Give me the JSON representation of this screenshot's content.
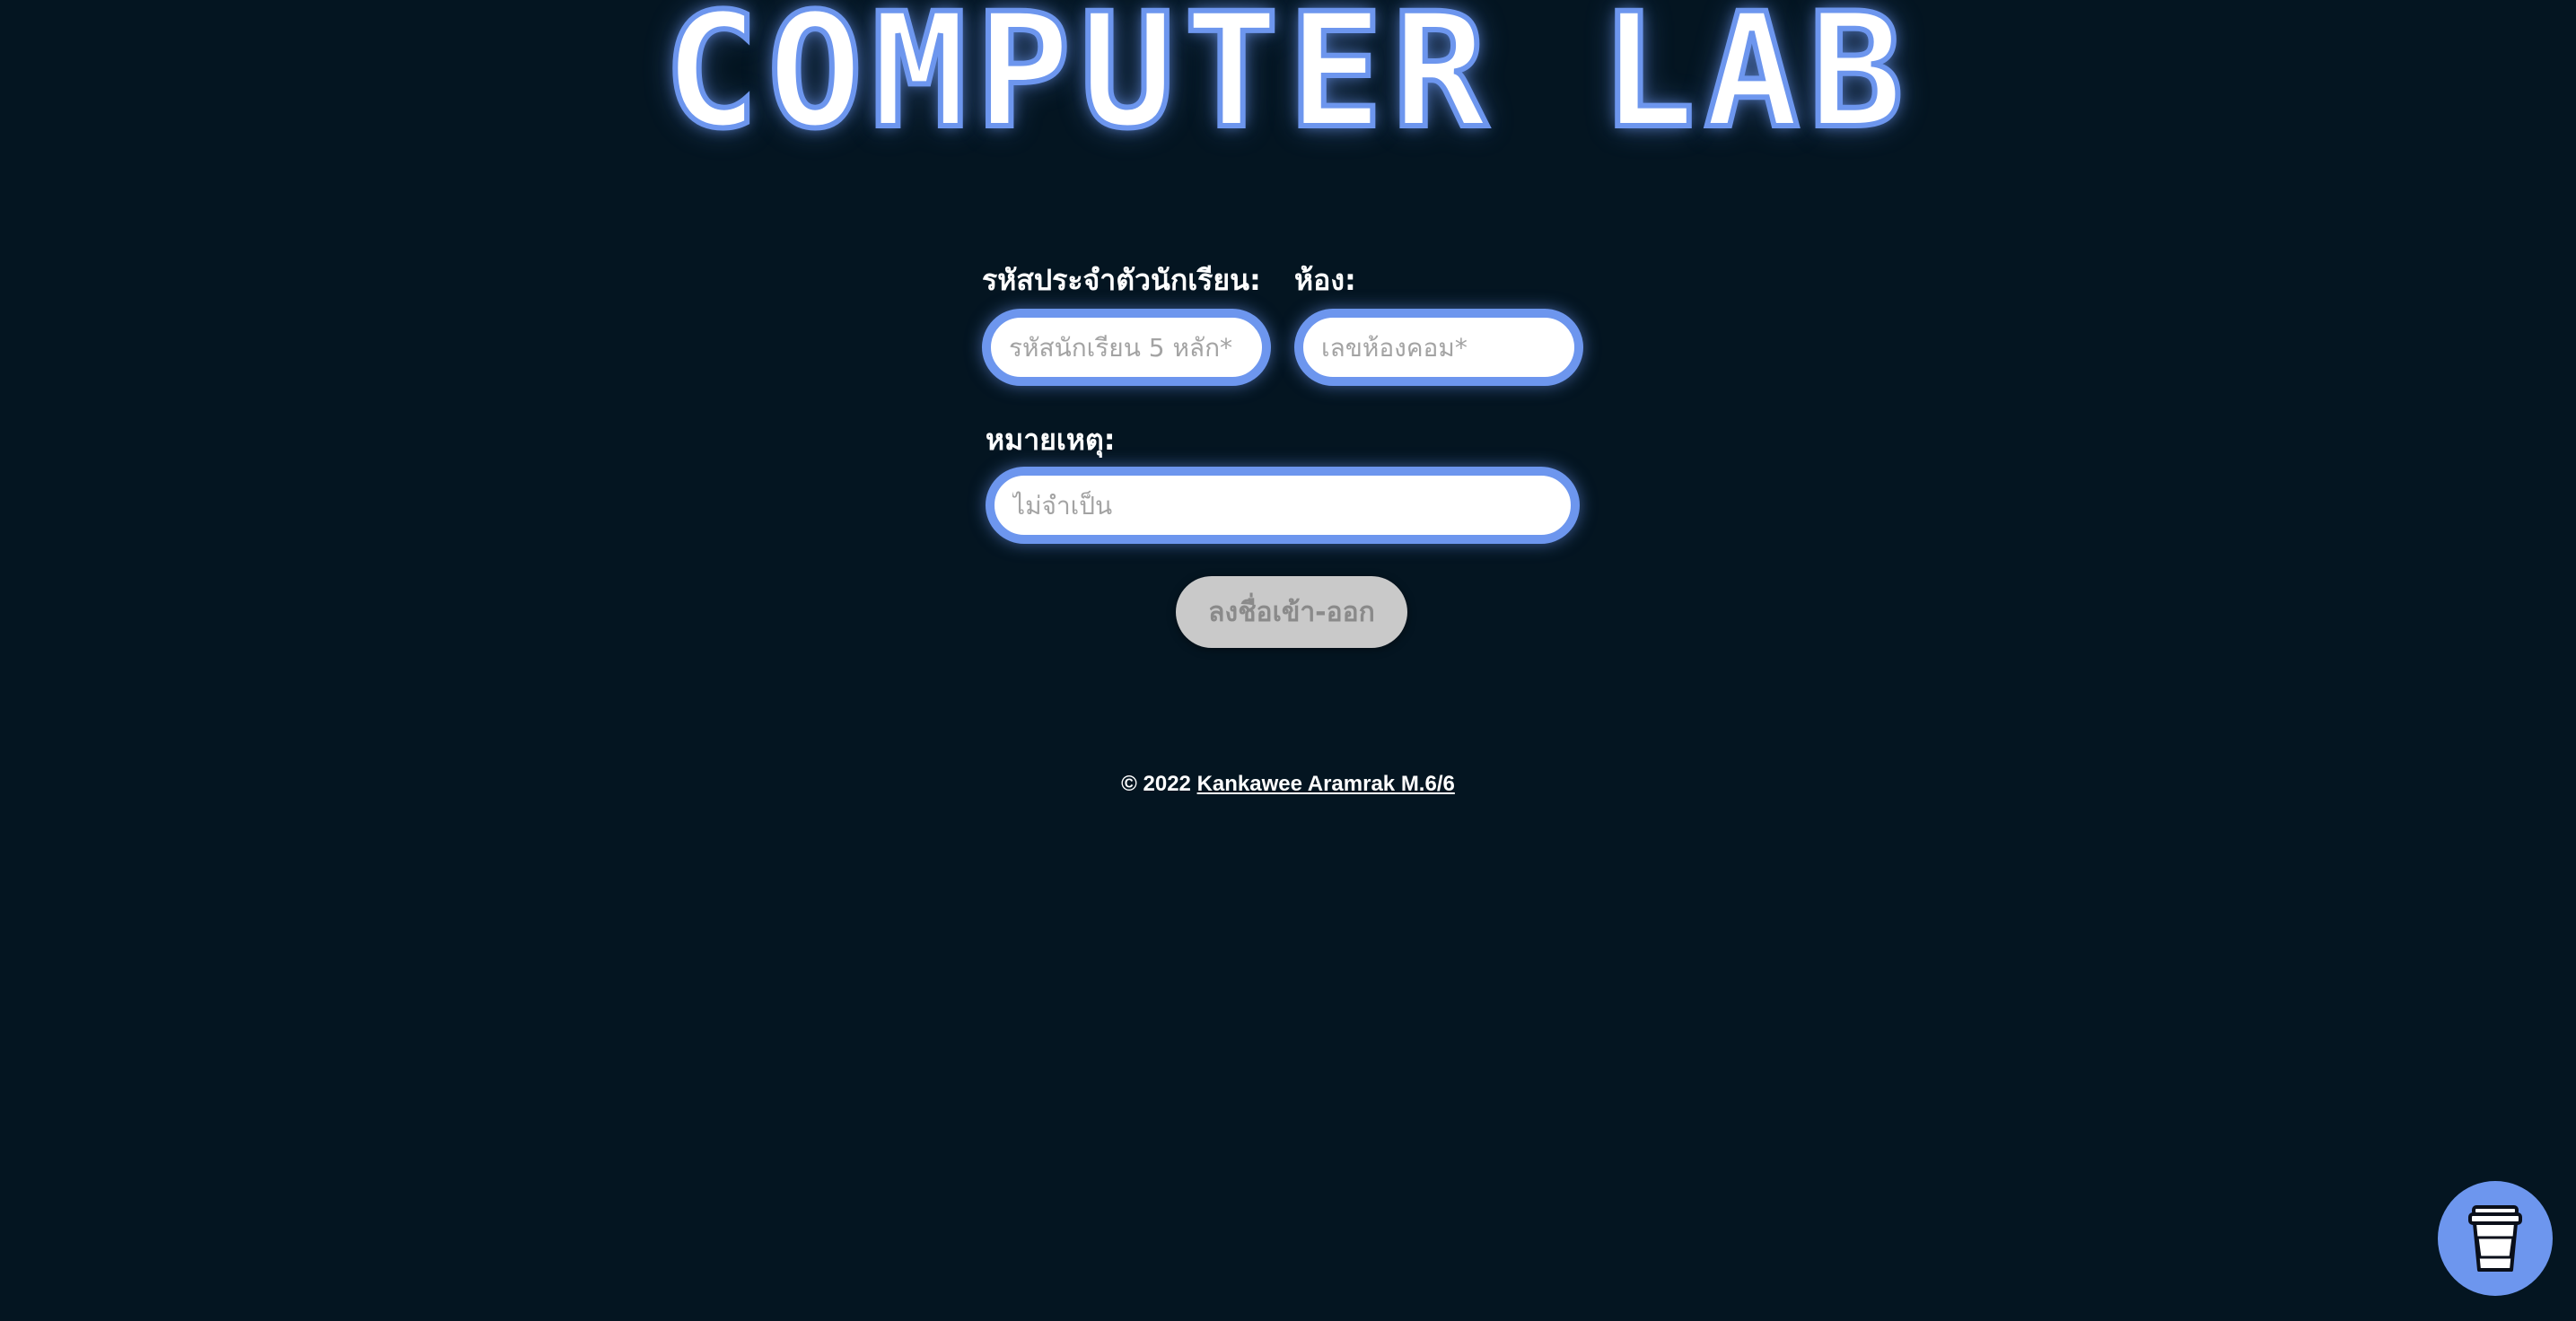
{
  "header": {
    "title": "COMPUTER LAB"
  },
  "form": {
    "student_id_label": "รหัสประจำตัวนักเรียน:",
    "student_id_placeholder": "รหัสนักเรียน 5 หลัก*",
    "room_label": "ห้อง:",
    "room_placeholder": "เลขห้องคอม*",
    "note_label": "หมายเหตุ:",
    "note_placeholder": "ไม่จำเป็น",
    "submit_label": "ลงชื่อเข้า-ออก"
  },
  "footer": {
    "copyright": "© 2022",
    "author_link": "Kankawee Aramrak M.6/6"
  },
  "widgets": {
    "coffee_icon": "coffee-cup-icon"
  },
  "colors": {
    "background": "#041521",
    "accent": "#6d96ee",
    "button_bg": "#c9c9c9"
  }
}
